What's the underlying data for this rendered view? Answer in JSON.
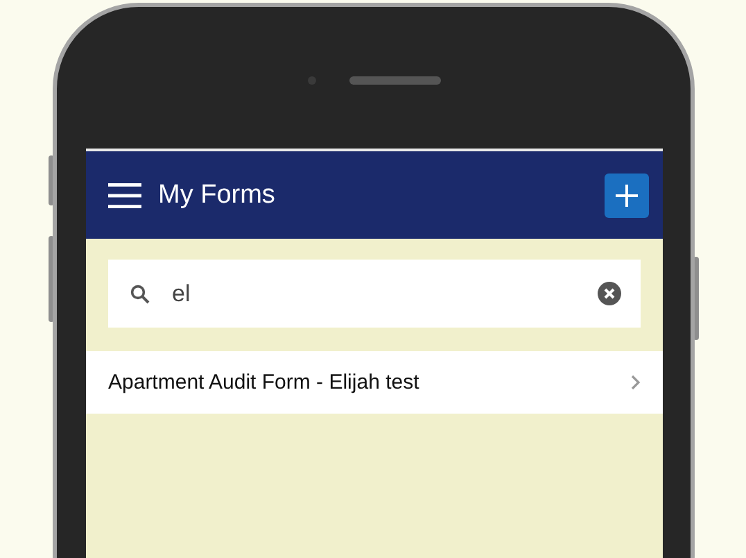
{
  "app_bar": {
    "title": "My Forms"
  },
  "search": {
    "value": "el"
  },
  "forms": [
    {
      "title": "Apartment Audit Form - Elijah test"
    }
  ]
}
